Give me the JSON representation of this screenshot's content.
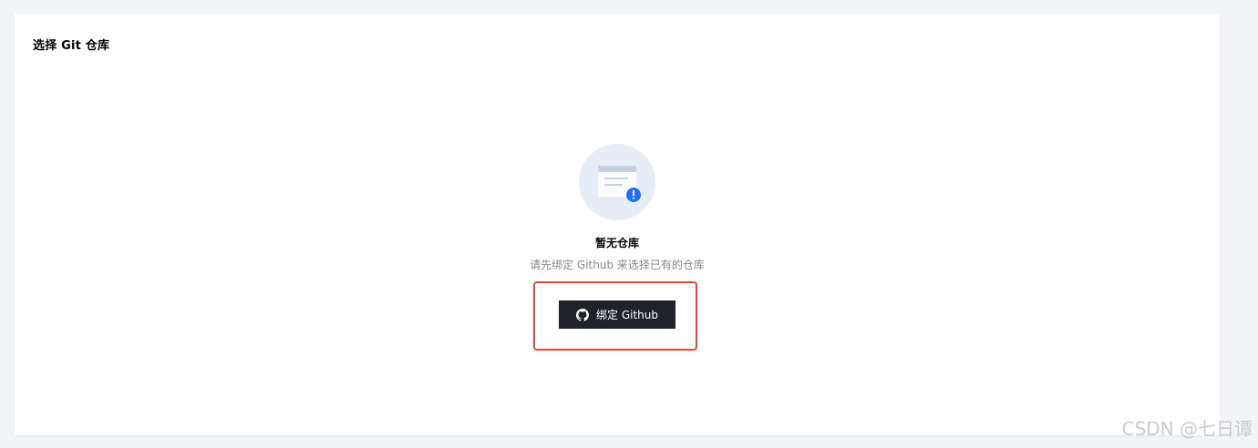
{
  "panel": {
    "title": "选择 Git 仓库"
  },
  "empty_state": {
    "illustration_icon": "empty-list-with-alert-icon",
    "title": "暂无仓库",
    "description": "请先绑定 Github 来选择已有的仓库"
  },
  "bind_button": {
    "icon": "github-icon",
    "label": "绑定 Github"
  },
  "watermark": {
    "text": "CSDN @七日谭"
  },
  "colors": {
    "page_background": "#f3f4f7",
    "card_background": "#ffffff",
    "button_background": "#1f2329",
    "button_text": "#ffffff",
    "highlight_border": "#e94436",
    "illustration_circle": "#e6edf6",
    "alert_badge": "#1e6fff",
    "description_text": "#888888"
  }
}
